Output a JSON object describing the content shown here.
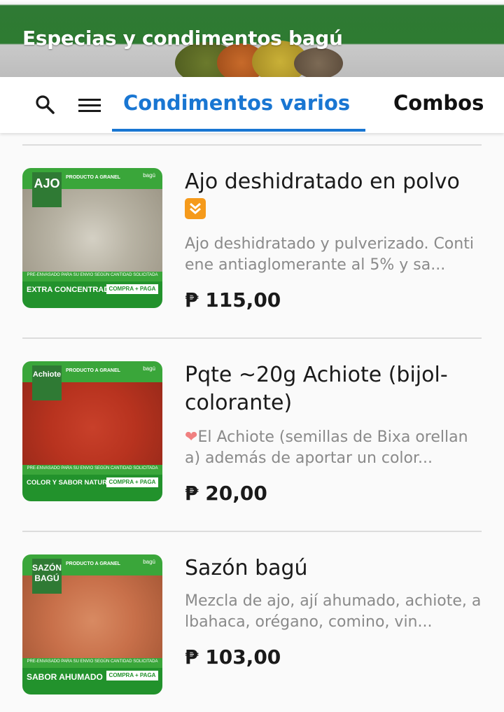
{
  "header": {
    "title": "Especias y condimentos bagú"
  },
  "tabs": [
    {
      "label": "Condimentos varios",
      "active": true
    },
    {
      "label": "Combos",
      "active": false
    }
  ],
  "colors": {
    "accent": "#1976d2",
    "banner_green": "#2e7b31",
    "thumb_green": "#22922c"
  },
  "icons": {
    "search": "search-icon",
    "menu": "menu-icon",
    "emoji": "double-down-arrow-icon",
    "heart": "heart-icon"
  },
  "products": [
    {
      "name": "Ajo deshidratado en polvo",
      "description": "Ajo deshidratado y pulverizado. Contiene antiaglomerante al 5% y sa...",
      "price": "₱ 115,00",
      "thumb": {
        "badge": "AJO",
        "top_label": "PRODUCTO A GRANEL",
        "brand": "bagú",
        "strip": "PRE-ENVASADO PARA SU ENVIO SEGÚN CANTIDAD SOLICITADA",
        "bottom_left": "EXTRA CONCENTRADO",
        "bottom_right": "COMPRA + PAGA"
      }
    },
    {
      "name": "Pqte ~20g Achiote (bijol-colorante)",
      "description": "El Achiote (semillas de Bixa orellana) además de aportar un color...",
      "price": "₱ 20,00",
      "thumb": {
        "badge": "Achiote",
        "top_label": "PRODUCTO A GRANEL",
        "brand": "bagú",
        "strip": "PRE-ENVASADO PARA SU ENVIO SEGÚN CANTIDAD SOLICITADA",
        "bottom_left": "COLOR Y SABOR NATURAL",
        "bottom_right": "COMPRA + PAGA"
      }
    },
    {
      "name": "Sazón bagú",
      "description": "Mezcla de ajo, ají ahumado, achiote, albahaca, orégano, comino, vin...",
      "price": "₱ 103,00",
      "thumb": {
        "badge": "SAZÓN BAGÚ",
        "top_label": "PRODUCTO A GRANEL",
        "brand": "bagú",
        "strip": "PRE-ENVASADO PARA SU ENVIO SEGÚN CANTIDAD SOLICITADA",
        "bottom_left": "SABOR AHUMADO",
        "bottom_right": "COMPRA + PAGA"
      }
    }
  ]
}
